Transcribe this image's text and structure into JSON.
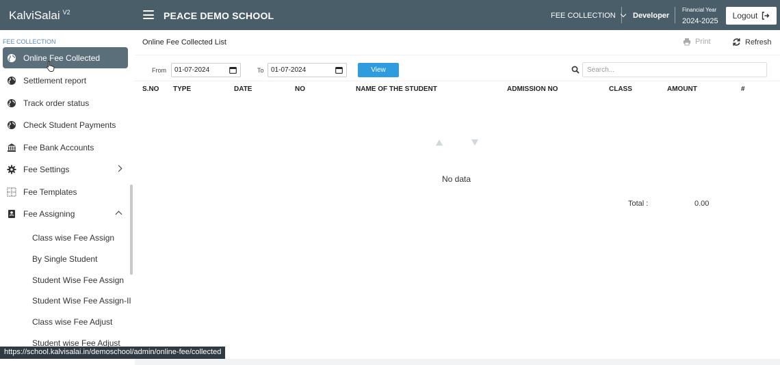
{
  "topbar": {
    "brand": "KalviSalai",
    "brand_version": "V2",
    "school_name": "PEACE DEMO SCHOOL",
    "module": "FEE COLLECTION",
    "user": "Developer",
    "financial_year_label": "Financial Year",
    "financial_year": "2024-2025",
    "logout_label": "Logout"
  },
  "sidebar": {
    "section": "FEE COLLECTION",
    "items": [
      {
        "label": "Online Fee Collected",
        "icon": "globe-icon"
      },
      {
        "label": "Settlement report",
        "icon": "globe-icon"
      },
      {
        "label": "Track order status",
        "icon": "globe-icon"
      },
      {
        "label": "Check Student Payments",
        "icon": "globe-icon"
      },
      {
        "label": "Fee Bank Accounts",
        "icon": "bank-icon"
      },
      {
        "label": "Fee Settings",
        "icon": "gear-icon"
      },
      {
        "label": "Fee Templates",
        "icon": "grid-icon"
      },
      {
        "label": "Fee Assigning",
        "icon": "book-icon"
      }
    ],
    "sub_items": [
      "Class wise Fee Assign",
      "By Single Student",
      "Student Wise Fee Assign",
      "Student Wise Fee Assign-II",
      "Class wise Fee Adjust",
      "Student wise Fee Adjust"
    ]
  },
  "status_url": "https://school.kalvisalai.in/demoschool/admin/online-fee/collected",
  "main": {
    "title": "Online Fee Collected List",
    "print_label": "Print",
    "refresh_label": "Refresh",
    "from_label": "From",
    "from_value": "01-07-2024",
    "to_label": "To",
    "to_value": "01-07-2024",
    "view_label": "View",
    "search_placeholder": "Search...",
    "columns": [
      "S.NO",
      "TYPE",
      "DATE",
      "NO",
      "NAME OF THE STUDENT",
      "ADMISSION NO",
      "CLASS",
      "AMOUNT",
      "#"
    ],
    "empty_text": "No data",
    "total_label": "Total :",
    "total_value": "0.00"
  },
  "colors": {
    "topbar": "#4a5e6a",
    "active_item": "#5b6f7b",
    "view_button": "#2f9ce0",
    "section_title": "#5a8bb0"
  }
}
